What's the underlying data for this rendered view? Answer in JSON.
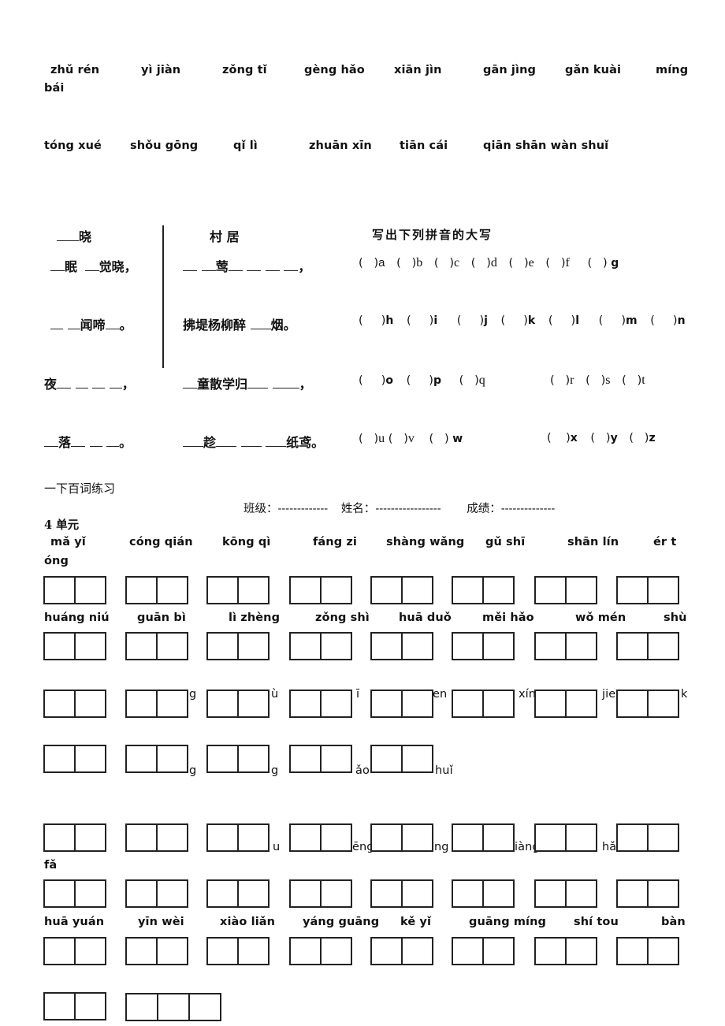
{
  "top_pinyin": {
    "row1": [
      "zhǔ rén",
      "yì jiàn",
      "zǒng tǐ",
      "gèng hǎo",
      "xiān jìn",
      "gān jìng",
      "gǎn kuài",
      "míng"
    ],
    "row1_wrap": "bái",
    "row2": [
      "tóng xué",
      "shǒu gōng",
      "qǐ lì",
      "zhuān xīn",
      "tiān cái",
      "qiān shān wàn shuǐ"
    ]
  },
  "poem1": {
    "title_suffix": "晓",
    "lines": [
      "眠",
      "觉晓，",
      "闻啼",
      "。",
      "夜",
      "，",
      "落",
      "。"
    ]
  },
  "poem2": {
    "title": "村  居",
    "line1_char": "莺",
    "line1_end": "，",
    "line2": "拂堤杨柳醉",
    "line2_end": "烟。",
    "line3": "童散学归",
    "line3_end": "，",
    "line4_mid": "趁",
    "line4_end": "纸鸢。"
  },
  "capitals": {
    "title": "写出下列拼音的大写",
    "rows": [
      [
        "a",
        "b",
        "c",
        "d",
        "e",
        "f",
        "g"
      ],
      [
        "h",
        "i",
        "j",
        "k",
        "l",
        "m",
        "n"
      ],
      [
        "o",
        "p",
        "q",
        "r",
        "s",
        "t"
      ],
      [
        "u",
        "v",
        "w",
        "x",
        "y",
        "z"
      ]
    ]
  },
  "practice": {
    "title": "一下百词练习",
    "class_label": "班级：",
    "class_blank": "-------------",
    "name_label": "姓名：",
    "name_blank": "-----------------",
    "score_label": "成绩：",
    "score_blank": "--------------",
    "unit_label": "4 单元",
    "row1": [
      "mǎ yǐ",
      "cóng qián",
      "kōng qì",
      "fáng zi",
      "shàng wǎng",
      "gǔ shī",
      "shān lín",
      "ér t"
    ],
    "row1_wrap": "óng",
    "row2": [
      "huáng niú",
      "guān bì",
      "lì zhèng",
      "zǒng shì",
      "huā duǒ",
      "měi hǎo",
      "wǒ mén",
      "shù"
    ],
    "row3_fragments": [
      "g",
      "ù",
      "ī",
      "en",
      "xín",
      "jie",
      "k"
    ],
    "row4_fragments": [
      "g",
      "g",
      "ǎo",
      "huǐ"
    ],
    "row5_fragments": [
      "u",
      "ēng",
      "ng",
      "iàng",
      "hǎ"
    ],
    "row5_wrap": "fǎ",
    "row6": [
      "huā yuán",
      "yīn wèi",
      "xiào liǎn",
      "yáng guāng",
      "kě yǐ",
      "guāng míng",
      "shí tou",
      "bàn"
    ]
  }
}
